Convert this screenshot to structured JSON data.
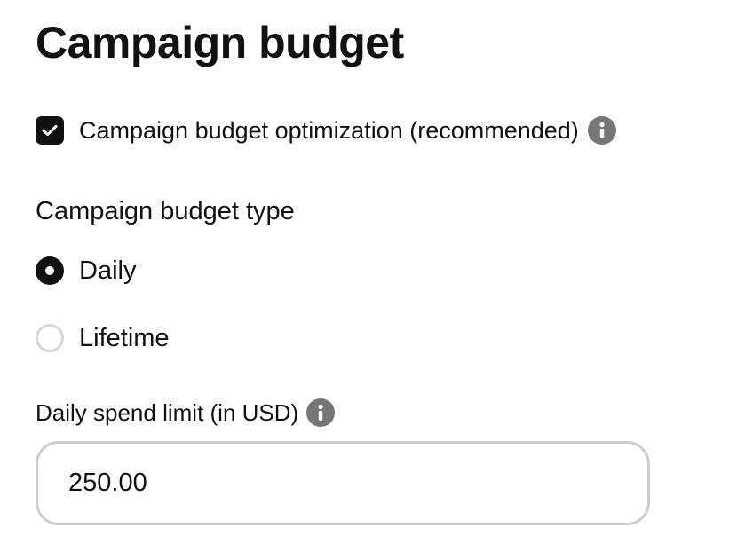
{
  "header": {
    "title": "Campaign budget"
  },
  "optimization": {
    "label": "Campaign budget optimization (recommended)",
    "checked": true,
    "info_icon": "info-icon"
  },
  "budget_type": {
    "label": "Campaign budget type",
    "options": [
      {
        "label": "Daily",
        "selected": true
      },
      {
        "label": "Lifetime",
        "selected": false
      }
    ]
  },
  "spend_limit": {
    "label": "Daily spend limit (in USD)",
    "value": "250.00",
    "info_icon": "info-icon"
  },
  "colors": {
    "text": "#111111",
    "control_dark": "#111111",
    "info_icon": "#767676",
    "radio_border": "#d6d6d6",
    "input_border": "#cdcdcd"
  }
}
